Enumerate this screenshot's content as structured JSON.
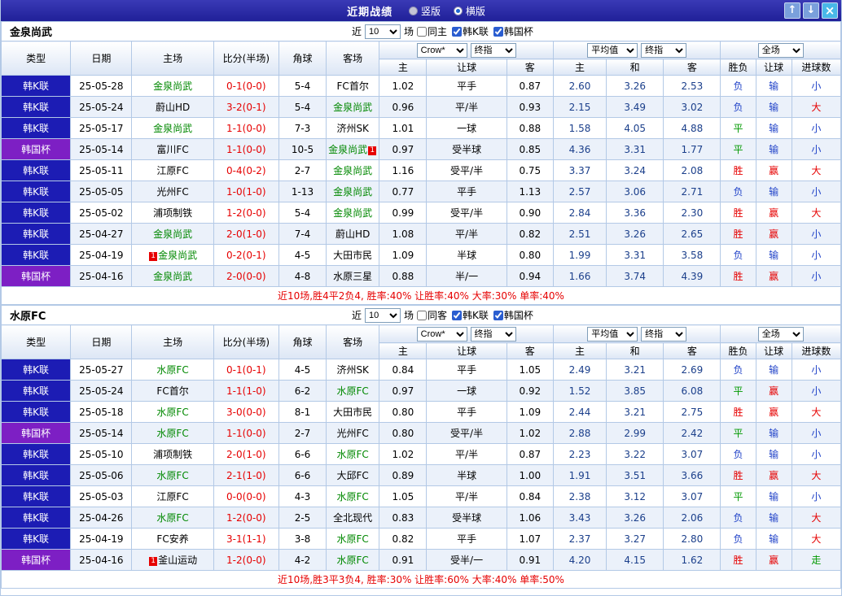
{
  "titlebar": {
    "title": "近期战绩",
    "view_options": [
      {
        "label": "竖版",
        "selected": false
      },
      {
        "label": "横版",
        "selected": true
      }
    ],
    "buttons": {
      "up": "↑",
      "down": "↓",
      "close": "×"
    }
  },
  "filter_labels": {
    "near": "近",
    "count": "10",
    "games": "场"
  },
  "table_header": {
    "col_type": "类型",
    "col_date": "日期",
    "col_home": "主场",
    "col_score": "比分(半场)",
    "col_corner": "角球",
    "col_away": "客场",
    "odds_selects": [
      "Crow*",
      "终指"
    ],
    "avg_selects": [
      "平均值",
      "终指"
    ],
    "scope_select": "全场",
    "sub": {
      "home": "主",
      "handicap": "让球",
      "away": "客",
      "avg_home": "主",
      "avg_draw": "和",
      "avg_away": "客",
      "result": "胜负",
      "handicap_result": "让球",
      "goals": "进球数"
    }
  },
  "result_colors": {
    "胜": "red",
    "平": "green",
    "负": "blue",
    "赢": "red",
    "输": "blue",
    "大": "red",
    "小": "blue",
    "走": "green"
  },
  "colors": {
    "titlebar": "#202098",
    "league_k": "#1c1cb4",
    "league_cup": "#7d1fc4",
    "focus_team": "#008800",
    "score": "#e60000",
    "avg_odds": "#1b3f8b",
    "win": "#e60000",
    "draw": "#009900",
    "lose": "#2143c8",
    "grid": "#b3c9e6",
    "alt_row": "#ebf1fa"
  },
  "sections": [
    {
      "team": "金泉尚武",
      "same_label": "同主",
      "leagues": [
        {
          "label": "韩K联",
          "checked": true
        },
        {
          "label": "韩国杯",
          "checked": true
        }
      ],
      "summary": "近10场,胜4平2负4, 胜率:40% 让胜率:40% 大率:30% 单率:40%",
      "rows": [
        {
          "t": "韩K联",
          "cup": false,
          "d": "25-05-28",
          "h": {
            "n": "金泉尚武",
            "f": true
          },
          "s": "0-1(0-0)",
          "c": "5-4",
          "a": {
            "n": "FC首尔"
          },
          "o": [
            "1.02",
            "平手",
            "0.87"
          ],
          "e": [
            "2.60",
            "3.26",
            "2.53"
          ],
          "r": "负",
          "hr": "输",
          "g": "小"
        },
        {
          "t": "韩K联",
          "cup": false,
          "d": "25-05-24",
          "h": {
            "n": "蔚山HD"
          },
          "s": "3-2(0-1)",
          "c": "5-4",
          "a": {
            "n": "金泉尚武",
            "f": true
          },
          "o": [
            "0.96",
            "平/半",
            "0.93"
          ],
          "e": [
            "2.15",
            "3.49",
            "3.02"
          ],
          "r": "负",
          "hr": "输",
          "g": "大"
        },
        {
          "t": "韩K联",
          "cup": false,
          "d": "25-05-17",
          "h": {
            "n": "金泉尚武",
            "f": true
          },
          "s": "1-1(0-0)",
          "c": "7-3",
          "a": {
            "n": "济州SK"
          },
          "o": [
            "1.01",
            "一球",
            "0.88"
          ],
          "e": [
            "1.58",
            "4.05",
            "4.88"
          ],
          "r": "平",
          "hr": "输",
          "g": "小"
        },
        {
          "t": "韩国杯",
          "cup": true,
          "d": "25-05-14",
          "h": {
            "n": "富川FC"
          },
          "s": "1-1(0-0)",
          "c": "10-5",
          "a": {
            "n": "金泉尚武",
            "f": true,
            "b": "1",
            "bp": "after"
          },
          "o": [
            "0.97",
            "受半球",
            "0.85"
          ],
          "e": [
            "4.36",
            "3.31",
            "1.77"
          ],
          "r": "平",
          "hr": "输",
          "g": "小"
        },
        {
          "t": "韩K联",
          "cup": false,
          "d": "25-05-11",
          "h": {
            "n": "江原FC"
          },
          "s": "0-4(0-2)",
          "c": "2-7",
          "a": {
            "n": "金泉尚武",
            "f": true
          },
          "o": [
            "1.16",
            "受平/半",
            "0.75"
          ],
          "e": [
            "3.37",
            "3.24",
            "2.08"
          ],
          "r": "胜",
          "hr": "赢",
          "g": "大"
        },
        {
          "t": "韩K联",
          "cup": false,
          "d": "25-05-05",
          "h": {
            "n": "光州FC"
          },
          "s": "1-0(1-0)",
          "c": "1-13",
          "a": {
            "n": "金泉尚武",
            "f": true
          },
          "o": [
            "0.77",
            "平手",
            "1.13"
          ],
          "e": [
            "2.57",
            "3.06",
            "2.71"
          ],
          "r": "负",
          "hr": "输",
          "g": "小"
        },
        {
          "t": "韩K联",
          "cup": false,
          "d": "25-05-02",
          "h": {
            "n": "浦项制铁"
          },
          "s": "1-2(0-0)",
          "c": "5-4",
          "a": {
            "n": "金泉尚武",
            "f": true
          },
          "o": [
            "0.99",
            "受平/半",
            "0.90"
          ],
          "e": [
            "2.84",
            "3.36",
            "2.30"
          ],
          "r": "胜",
          "hr": "赢",
          "g": "大"
        },
        {
          "t": "韩K联",
          "cup": false,
          "d": "25-04-27",
          "h": {
            "n": "金泉尚武",
            "f": true
          },
          "s": "2-0(1-0)",
          "c": "7-4",
          "a": {
            "n": "蔚山HD"
          },
          "o": [
            "1.08",
            "平/半",
            "0.82"
          ],
          "e": [
            "2.51",
            "3.26",
            "2.65"
          ],
          "r": "胜",
          "hr": "赢",
          "g": "小"
        },
        {
          "t": "韩K联",
          "cup": false,
          "d": "25-04-19",
          "h": {
            "n": "金泉尚武",
            "f": true,
            "b": "1",
            "bp": "before"
          },
          "s": "0-2(0-1)",
          "c": "4-5",
          "a": {
            "n": "大田市民"
          },
          "o": [
            "1.09",
            "半球",
            "0.80"
          ],
          "e": [
            "1.99",
            "3.31",
            "3.58"
          ],
          "r": "负",
          "hr": "输",
          "g": "小"
        },
        {
          "t": "韩国杯",
          "cup": true,
          "d": "25-04-16",
          "h": {
            "n": "金泉尚武",
            "f": true
          },
          "s": "2-0(0-0)",
          "c": "4-8",
          "a": {
            "n": "水原三星"
          },
          "o": [
            "0.88",
            "半/一",
            "0.94"
          ],
          "e": [
            "1.66",
            "3.74",
            "4.39"
          ],
          "r": "胜",
          "hr": "赢",
          "g": "小"
        }
      ]
    },
    {
      "team": "水原FC",
      "same_label": "同客",
      "leagues": [
        {
          "label": "韩K联",
          "checked": true
        },
        {
          "label": "韩国杯",
          "checked": true
        }
      ],
      "summary": "近10场,胜3平3负4, 胜率:30% 让胜率:60% 大率:40% 单率:50%",
      "rows": [
        {
          "t": "韩K联",
          "cup": false,
          "d": "25-05-27",
          "h": {
            "n": "水原FC",
            "f": true
          },
          "s": "0-1(0-1)",
          "c": "4-5",
          "a": {
            "n": "济州SK"
          },
          "o": [
            "0.84",
            "平手",
            "1.05"
          ],
          "e": [
            "2.49",
            "3.21",
            "2.69"
          ],
          "r": "负",
          "hr": "输",
          "g": "小"
        },
        {
          "t": "韩K联",
          "cup": false,
          "d": "25-05-24",
          "h": {
            "n": "FC首尔"
          },
          "s": "1-1(1-0)",
          "c": "6-2",
          "a": {
            "n": "水原FC",
            "f": true
          },
          "o": [
            "0.97",
            "一球",
            "0.92"
          ],
          "e": [
            "1.52",
            "3.85",
            "6.08"
          ],
          "r": "平",
          "hr": "赢",
          "g": "小"
        },
        {
          "t": "韩K联",
          "cup": false,
          "d": "25-05-18",
          "h": {
            "n": "水原FC",
            "f": true
          },
          "s": "3-0(0-0)",
          "c": "8-1",
          "a": {
            "n": "大田市民"
          },
          "o": [
            "0.80",
            "平手",
            "1.09"
          ],
          "e": [
            "2.44",
            "3.21",
            "2.75"
          ],
          "r": "胜",
          "hr": "赢",
          "g": "大"
        },
        {
          "t": "韩国杯",
          "cup": true,
          "d": "25-05-14",
          "h": {
            "n": "水原FC",
            "f": true
          },
          "s": "1-1(0-0)",
          "c": "2-7",
          "a": {
            "n": "光州FC"
          },
          "o": [
            "0.80",
            "受平/半",
            "1.02"
          ],
          "e": [
            "2.88",
            "2.99",
            "2.42"
          ],
          "r": "平",
          "hr": "输",
          "g": "小"
        },
        {
          "t": "韩K联",
          "cup": false,
          "d": "25-05-10",
          "h": {
            "n": "浦项制铁"
          },
          "s": "2-0(1-0)",
          "c": "6-6",
          "a": {
            "n": "水原FC",
            "f": true
          },
          "o": [
            "1.02",
            "平/半",
            "0.87"
          ],
          "e": [
            "2.23",
            "3.22",
            "3.07"
          ],
          "r": "负",
          "hr": "输",
          "g": "小"
        },
        {
          "t": "韩K联",
          "cup": false,
          "d": "25-05-06",
          "h": {
            "n": "水原FC",
            "f": true
          },
          "s": "2-1(1-0)",
          "c": "6-6",
          "a": {
            "n": "大邱FC"
          },
          "o": [
            "0.89",
            "半球",
            "1.00"
          ],
          "e": [
            "1.91",
            "3.51",
            "3.66"
          ],
          "r": "胜",
          "hr": "赢",
          "g": "大"
        },
        {
          "t": "韩K联",
          "cup": false,
          "d": "25-05-03",
          "h": {
            "n": "江原FC"
          },
          "s": "0-0(0-0)",
          "c": "4-3",
          "a": {
            "n": "水原FC",
            "f": true
          },
          "o": [
            "1.05",
            "平/半",
            "0.84"
          ],
          "e": [
            "2.38",
            "3.12",
            "3.07"
          ],
          "r": "平",
          "hr": "输",
          "g": "小"
        },
        {
          "t": "韩K联",
          "cup": false,
          "d": "25-04-26",
          "h": {
            "n": "水原FC",
            "f": true
          },
          "s": "1-2(0-0)",
          "c": "2-5",
          "a": {
            "n": "全北现代"
          },
          "o": [
            "0.83",
            "受半球",
            "1.06"
          ],
          "e": [
            "3.43",
            "3.26",
            "2.06"
          ],
          "r": "负",
          "hr": "输",
          "g": "大"
        },
        {
          "t": "韩K联",
          "cup": false,
          "d": "25-04-19",
          "h": {
            "n": "FC安养"
          },
          "s": "3-1(1-1)",
          "c": "3-8",
          "a": {
            "n": "水原FC",
            "f": true
          },
          "o": [
            "0.82",
            "平手",
            "1.07"
          ],
          "e": [
            "2.37",
            "3.27",
            "2.80"
          ],
          "r": "负",
          "hr": "输",
          "g": "大"
        },
        {
          "t": "韩国杯",
          "cup": true,
          "d": "25-04-16",
          "h": {
            "n": "釜山运动",
            "b": "1",
            "bp": "before"
          },
          "s": "1-2(0-0)",
          "c": "4-2",
          "a": {
            "n": "水原FC",
            "f": true
          },
          "o": [
            "0.91",
            "受半/一",
            "0.91"
          ],
          "e": [
            "4.20",
            "4.15",
            "1.62"
          ],
          "r": "胜",
          "hr": "赢",
          "g": "走"
        }
      ]
    }
  ]
}
